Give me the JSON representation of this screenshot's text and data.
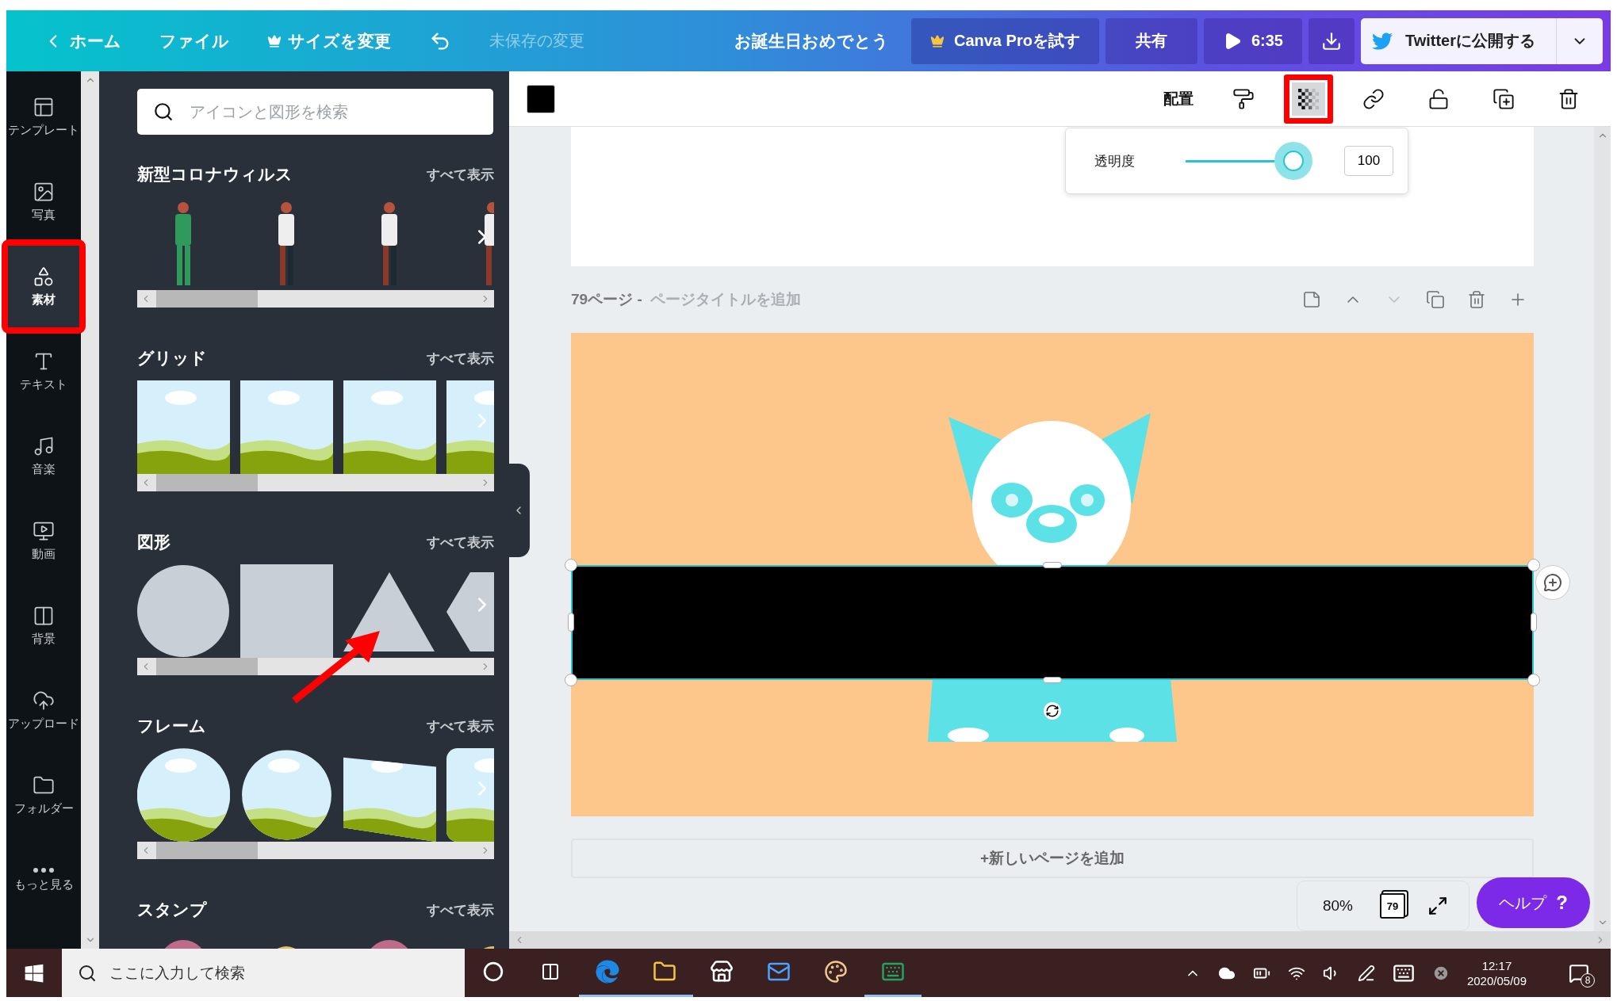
{
  "topbar": {
    "back": "ホーム",
    "file": "ファイル",
    "resize": "サイズを変更",
    "save_status": "未保存の変更",
    "title": "お誕生日おめでとう",
    "pro": "Canva Proを試す",
    "share": "共有",
    "play": "6:35",
    "publish": "Twitterに公開する"
  },
  "sidebar": {
    "items": [
      {
        "label": "テンプレート",
        "kind": "template",
        "selected": false,
        "highlighted": false
      },
      {
        "label": "写真",
        "kind": "photo",
        "selected": false,
        "highlighted": false
      },
      {
        "label": "素材",
        "kind": "elements",
        "selected": true,
        "highlighted": true
      },
      {
        "label": "テキスト",
        "kind": "text",
        "selected": false,
        "highlighted": false
      },
      {
        "label": "音楽",
        "kind": "music",
        "selected": false,
        "highlighted": false
      },
      {
        "label": "動画",
        "kind": "video",
        "selected": false,
        "highlighted": false
      },
      {
        "label": "背景",
        "kind": "background",
        "selected": false,
        "highlighted": false
      },
      {
        "label": "アップロード",
        "kind": "upload",
        "selected": false,
        "highlighted": false
      },
      {
        "label": "フォルダー",
        "kind": "folder",
        "selected": false,
        "highlighted": false
      },
      {
        "label": "もっと見る",
        "kind": "more",
        "selected": false,
        "highlighted": false
      }
    ]
  },
  "panel": {
    "search": {
      "placeholder": "アイコンと図形を検索"
    },
    "sections": [
      {
        "title": "新型コロナウィルス",
        "link": "すべて表示",
        "kind": "people"
      },
      {
        "title": "グリッド",
        "link": "すべて表示",
        "kind": "grid"
      },
      {
        "title": "図形",
        "link": "すべて表示",
        "kind": "shapes"
      },
      {
        "title": "フレーム",
        "link": "すべて表示",
        "kind": "frames"
      },
      {
        "title": "スタンプ",
        "link": "すべて表示",
        "kind": "stamps"
      }
    ]
  },
  "toolbar": {
    "color": "#000000",
    "arrange": "配置",
    "tools": [
      {
        "kind": "paint",
        "selected": false,
        "highlighted": false
      },
      {
        "kind": "transparency",
        "selected": true,
        "highlighted": true
      },
      {
        "kind": "link",
        "selected": false,
        "highlighted": false
      },
      {
        "kind": "lock",
        "selected": false,
        "highlighted": false
      },
      {
        "kind": "duplicate",
        "selected": false,
        "highlighted": false
      },
      {
        "kind": "delete",
        "selected": false,
        "highlighted": false
      }
    ]
  },
  "transparency": {
    "label": "透明度",
    "level": 1,
    "value": "100"
  },
  "page": {
    "number": "79ページ -",
    "title_placeholder": "ページタイトルを追加",
    "actions": [
      {
        "kind": "note",
        "disabled": false
      },
      {
        "kind": "up",
        "disabled": false
      },
      {
        "kind": "down",
        "disabled": true
      },
      {
        "kind": "copy",
        "disabled": false
      },
      {
        "kind": "delete",
        "disabled": false
      },
      {
        "kind": "add",
        "disabled": false
      }
    ]
  },
  "add_page": "+新しいページを追加",
  "zoom": {
    "value": "80%",
    "pages": "79"
  },
  "help": {
    "label": "ヘルプ",
    "mark": "?"
  },
  "taskbar": {
    "search": {
      "placeholder": "ここに入力して検索"
    },
    "apps": [
      {
        "kind": "edge",
        "running": true
      },
      {
        "kind": "explorer",
        "running": true
      },
      {
        "kind": "store",
        "running": false
      },
      {
        "kind": "mail",
        "running": false
      },
      {
        "kind": "paint",
        "running": false
      },
      {
        "kind": "excel",
        "running": true
      }
    ],
    "time": "12:17",
    "date": "2020/05/09",
    "notifications": "8"
  }
}
